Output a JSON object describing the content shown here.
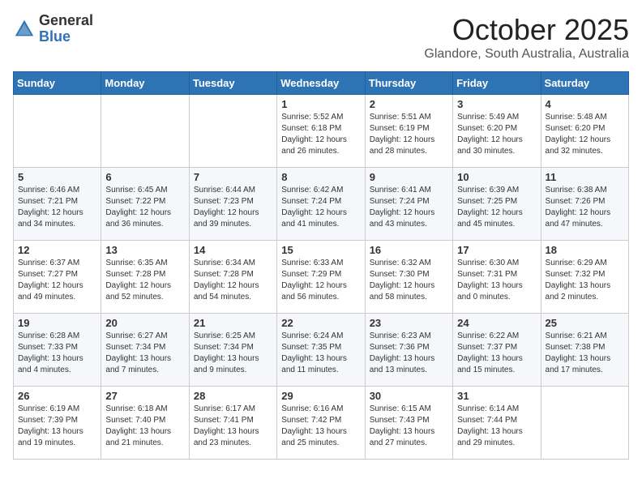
{
  "logo": {
    "general": "General",
    "blue": "Blue"
  },
  "header": {
    "month": "October 2025",
    "location": "Glandore, South Australia, Australia"
  },
  "weekdays": [
    "Sunday",
    "Monday",
    "Tuesday",
    "Wednesday",
    "Thursday",
    "Friday",
    "Saturday"
  ],
  "weeks": [
    [
      {
        "day": "",
        "info": ""
      },
      {
        "day": "",
        "info": ""
      },
      {
        "day": "",
        "info": ""
      },
      {
        "day": "1",
        "info": "Sunrise: 5:52 AM\nSunset: 6:18 PM\nDaylight: 12 hours\nand 26 minutes."
      },
      {
        "day": "2",
        "info": "Sunrise: 5:51 AM\nSunset: 6:19 PM\nDaylight: 12 hours\nand 28 minutes."
      },
      {
        "day": "3",
        "info": "Sunrise: 5:49 AM\nSunset: 6:20 PM\nDaylight: 12 hours\nand 30 minutes."
      },
      {
        "day": "4",
        "info": "Sunrise: 5:48 AM\nSunset: 6:20 PM\nDaylight: 12 hours\nand 32 minutes."
      }
    ],
    [
      {
        "day": "5",
        "info": "Sunrise: 6:46 AM\nSunset: 7:21 PM\nDaylight: 12 hours\nand 34 minutes."
      },
      {
        "day": "6",
        "info": "Sunrise: 6:45 AM\nSunset: 7:22 PM\nDaylight: 12 hours\nand 36 minutes."
      },
      {
        "day": "7",
        "info": "Sunrise: 6:44 AM\nSunset: 7:23 PM\nDaylight: 12 hours\nand 39 minutes."
      },
      {
        "day": "8",
        "info": "Sunrise: 6:42 AM\nSunset: 7:24 PM\nDaylight: 12 hours\nand 41 minutes."
      },
      {
        "day": "9",
        "info": "Sunrise: 6:41 AM\nSunset: 7:24 PM\nDaylight: 12 hours\nand 43 minutes."
      },
      {
        "day": "10",
        "info": "Sunrise: 6:39 AM\nSunset: 7:25 PM\nDaylight: 12 hours\nand 45 minutes."
      },
      {
        "day": "11",
        "info": "Sunrise: 6:38 AM\nSunset: 7:26 PM\nDaylight: 12 hours\nand 47 minutes."
      }
    ],
    [
      {
        "day": "12",
        "info": "Sunrise: 6:37 AM\nSunset: 7:27 PM\nDaylight: 12 hours\nand 49 minutes."
      },
      {
        "day": "13",
        "info": "Sunrise: 6:35 AM\nSunset: 7:28 PM\nDaylight: 12 hours\nand 52 minutes."
      },
      {
        "day": "14",
        "info": "Sunrise: 6:34 AM\nSunset: 7:28 PM\nDaylight: 12 hours\nand 54 minutes."
      },
      {
        "day": "15",
        "info": "Sunrise: 6:33 AM\nSunset: 7:29 PM\nDaylight: 12 hours\nand 56 minutes."
      },
      {
        "day": "16",
        "info": "Sunrise: 6:32 AM\nSunset: 7:30 PM\nDaylight: 12 hours\nand 58 minutes."
      },
      {
        "day": "17",
        "info": "Sunrise: 6:30 AM\nSunset: 7:31 PM\nDaylight: 13 hours\nand 0 minutes."
      },
      {
        "day": "18",
        "info": "Sunrise: 6:29 AM\nSunset: 7:32 PM\nDaylight: 13 hours\nand 2 minutes."
      }
    ],
    [
      {
        "day": "19",
        "info": "Sunrise: 6:28 AM\nSunset: 7:33 PM\nDaylight: 13 hours\nand 4 minutes."
      },
      {
        "day": "20",
        "info": "Sunrise: 6:27 AM\nSunset: 7:34 PM\nDaylight: 13 hours\nand 7 minutes."
      },
      {
        "day": "21",
        "info": "Sunrise: 6:25 AM\nSunset: 7:34 PM\nDaylight: 13 hours\nand 9 minutes."
      },
      {
        "day": "22",
        "info": "Sunrise: 6:24 AM\nSunset: 7:35 PM\nDaylight: 13 hours\nand 11 minutes."
      },
      {
        "day": "23",
        "info": "Sunrise: 6:23 AM\nSunset: 7:36 PM\nDaylight: 13 hours\nand 13 minutes."
      },
      {
        "day": "24",
        "info": "Sunrise: 6:22 AM\nSunset: 7:37 PM\nDaylight: 13 hours\nand 15 minutes."
      },
      {
        "day": "25",
        "info": "Sunrise: 6:21 AM\nSunset: 7:38 PM\nDaylight: 13 hours\nand 17 minutes."
      }
    ],
    [
      {
        "day": "26",
        "info": "Sunrise: 6:19 AM\nSunset: 7:39 PM\nDaylight: 13 hours\nand 19 minutes."
      },
      {
        "day": "27",
        "info": "Sunrise: 6:18 AM\nSunset: 7:40 PM\nDaylight: 13 hours\nand 21 minutes."
      },
      {
        "day": "28",
        "info": "Sunrise: 6:17 AM\nSunset: 7:41 PM\nDaylight: 13 hours\nand 23 minutes."
      },
      {
        "day": "29",
        "info": "Sunrise: 6:16 AM\nSunset: 7:42 PM\nDaylight: 13 hours\nand 25 minutes."
      },
      {
        "day": "30",
        "info": "Sunrise: 6:15 AM\nSunset: 7:43 PM\nDaylight: 13 hours\nand 27 minutes."
      },
      {
        "day": "31",
        "info": "Sunrise: 6:14 AM\nSunset: 7:44 PM\nDaylight: 13 hours\nand 29 minutes."
      },
      {
        "day": "",
        "info": ""
      }
    ]
  ]
}
